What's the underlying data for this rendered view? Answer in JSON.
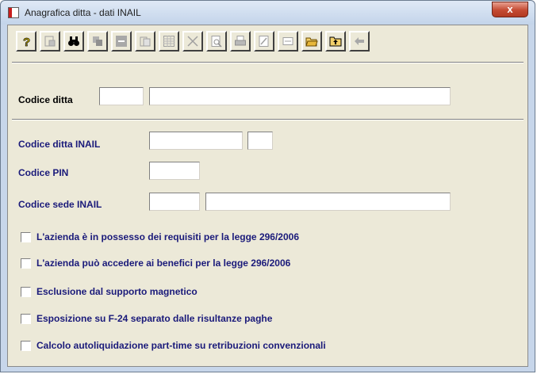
{
  "window": {
    "title": "Anagrafica ditta - dati INAIL",
    "close_glyph": "x"
  },
  "toolbar": {
    "buttons": [
      {
        "icon": "help-icon",
        "enabled": true
      },
      {
        "icon": "properties-icon",
        "enabled": false
      },
      {
        "icon": "search-binoculars-icon",
        "enabled": true
      },
      {
        "icon": "copy-icon",
        "enabled": false
      },
      {
        "icon": "minus-icon",
        "enabled": false
      },
      {
        "icon": "paste-icon",
        "enabled": false
      },
      {
        "icon": "grid-icon",
        "enabled": false
      },
      {
        "icon": "delete-x-icon",
        "enabled": false
      },
      {
        "icon": "preview-icon",
        "enabled": false
      },
      {
        "icon": "print-icon",
        "enabled": false
      },
      {
        "icon": "export-icon",
        "enabled": false
      },
      {
        "icon": "form-icon",
        "enabled": false
      },
      {
        "icon": "open-folder-icon",
        "enabled": true
      },
      {
        "icon": "folder-up-icon",
        "enabled": true
      },
      {
        "icon": "back-arrow-icon",
        "enabled": false
      }
    ]
  },
  "form": {
    "codice_ditta": {
      "label": "Codice ditta",
      "code": "",
      "name": ""
    },
    "codice_ditta_inail": {
      "label": "Codice ditta INAIL",
      "value": "",
      "suffix": ""
    },
    "codice_pin": {
      "label": "Codice PIN",
      "value": ""
    },
    "codice_sede_inail": {
      "label": "Codice sede INAIL",
      "code": "",
      "description": ""
    }
  },
  "checkboxes": [
    {
      "label": "L'azienda è in possesso dei requisiti per la legge 296/2006",
      "checked": false
    },
    {
      "label": "L'azienda può accedere ai benefici per la legge 296/2006",
      "checked": false
    },
    {
      "label": "Esclusione dal supporto magnetico",
      "checked": false
    },
    {
      "label": "Esposizione su F-24 separato dalle risultanze paghe",
      "checked": false
    },
    {
      "label": "Calcolo autoliquidazione part-time su retribuzioni convenzionali",
      "checked": false
    }
  ],
  "colors": {
    "label_blue": "#1a1a7a",
    "dialog_bg": "#ece9d8",
    "frame_bg": "#c7d6ea"
  }
}
